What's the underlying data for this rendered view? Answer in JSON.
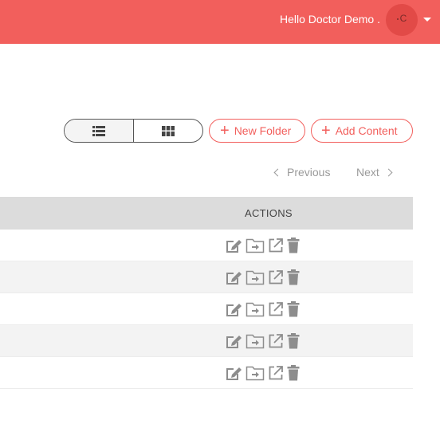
{
  "header": {
    "greeting": "Hello Doctor Demo .",
    "avatar_initial": "C",
    "brand_color": "#f25f5c"
  },
  "toolbar": {
    "view_toggle": [
      {
        "name": "list-view",
        "icon": "list-icon",
        "active": true
      },
      {
        "name": "grid-view",
        "icon": "grid-icon",
        "active": false
      }
    ],
    "new_folder_label": "New Folder",
    "add_content_label": "Add Content"
  },
  "pagination": {
    "previous_label": "Previous",
    "next_label": "Next"
  },
  "table": {
    "columns": [
      "ACTIONS"
    ],
    "rows": [
      {
        "actions": [
          "edit-icon",
          "move-to-folder-icon",
          "open-external-icon",
          "trash-icon"
        ]
      },
      {
        "actions": [
          "edit-icon",
          "move-to-folder-icon",
          "open-external-icon",
          "trash-icon"
        ]
      },
      {
        "actions": [
          "edit-icon",
          "move-to-folder-icon",
          "open-external-icon",
          "trash-icon"
        ]
      },
      {
        "actions": [
          "edit-icon",
          "move-to-folder-icon",
          "open-external-icon",
          "trash-icon"
        ]
      },
      {
        "actions": [
          "edit-icon",
          "move-to-folder-icon",
          "open-external-icon",
          "trash-icon"
        ]
      }
    ]
  }
}
